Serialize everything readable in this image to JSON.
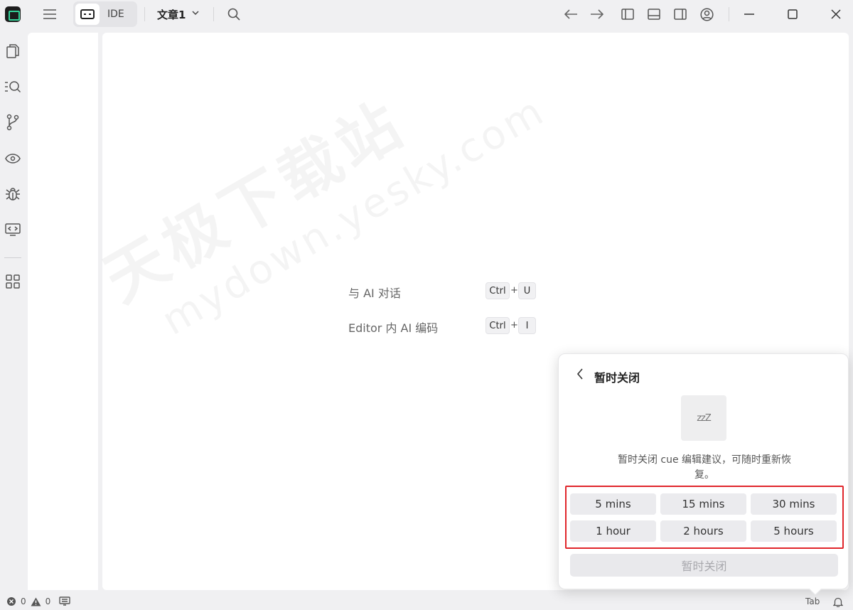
{
  "titlebar": {
    "mode_label": "IDE",
    "document_title": "文章1"
  },
  "editor": {
    "watermark_cn": "天极下载站",
    "watermark_en": "mydown.yesky.com",
    "hints": [
      {
        "label": "与 AI 对话",
        "keys": [
          "Ctrl",
          "U"
        ]
      },
      {
        "label": "Editor 内 AI 编码",
        "keys": [
          "Ctrl",
          "I"
        ]
      }
    ],
    "plus": "+"
  },
  "statusbar": {
    "errors": "0",
    "warnings": "0",
    "tab_label": "Tab"
  },
  "snooze_popover": {
    "title": "暂时关闭",
    "description": "暂时关闭 cue 编辑建议，可随时重新恢复。",
    "zz_glyph": "zzZ",
    "options": [
      "5 mins",
      "15 mins",
      "30 mins",
      "1 hour",
      "2 hours",
      "5 hours"
    ],
    "primary_button": "暂时关闭"
  }
}
